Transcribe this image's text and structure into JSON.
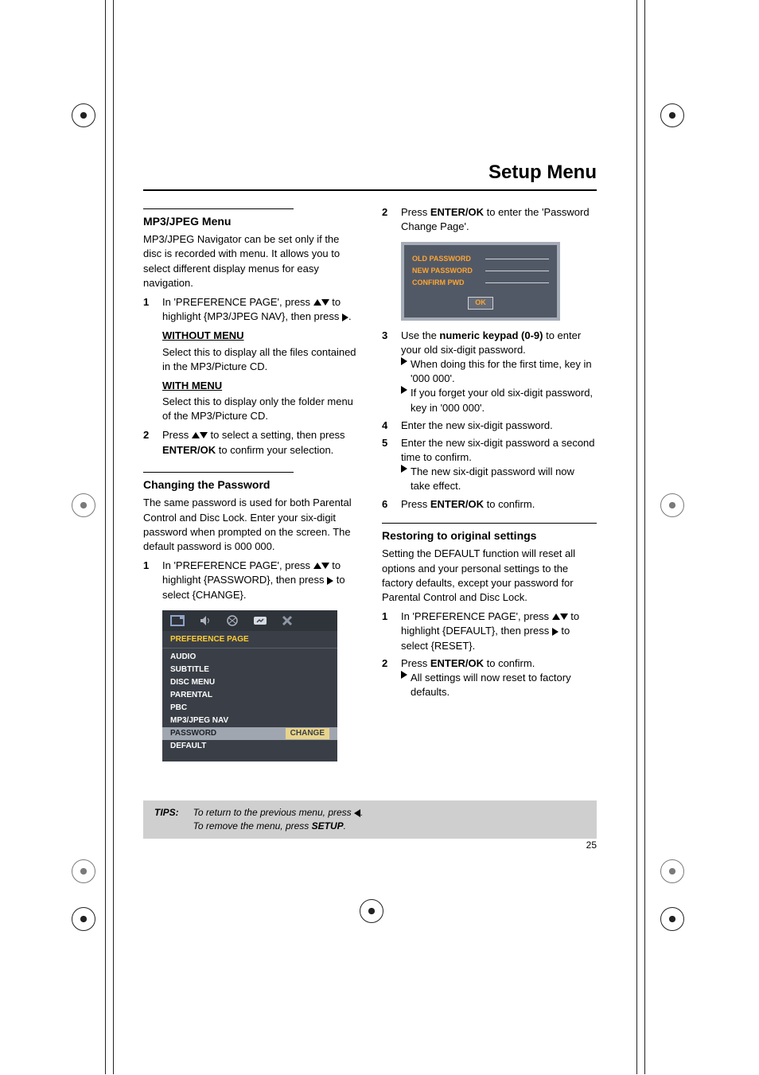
{
  "header": {
    "title": "Setup Menu"
  },
  "left": {
    "mp3jpeg": {
      "heading": "MP3/JPEG Menu",
      "intro": "MP3/JPEG Navigator can be set only if the disc is recorded with menu. It allows you to select different display menus for easy navigation.",
      "step1_a": "In 'PREFERENCE PAGE', press ",
      "step1_b": " to highlight {MP3/JPEG NAV}, then press ",
      "step1_c": ".",
      "without_h": "WITHOUT MENU",
      "without_t": "Select this to display all the files contained in the MP3/Picture CD.",
      "with_h": "WITH MENU",
      "with_t": "Select this to display only the folder menu of the MP3/Picture CD.",
      "step2_a": "Press ",
      "step2_b": " to select a setting, then press ",
      "step2_enter": "ENTER/OK",
      "step2_c": " to confirm your selection."
    },
    "pw": {
      "heading": "Changing the Password",
      "intro": "The same password is used for both Parental Control and Disc Lock. Enter your six-digit password when prompted on the screen. The default password is 000 000.",
      "step1_a": "In 'PREFERENCE PAGE', press ",
      "step1_b": " to highlight {PASSWORD}, then press ",
      "step1_c": " to select {CHANGE}."
    },
    "osd": {
      "title": "PREFERENCE PAGE",
      "rows": [
        {
          "k": "AUDIO",
          "v": ""
        },
        {
          "k": "SUBTITLE",
          "v": ""
        },
        {
          "k": "DISC MENU",
          "v": ""
        },
        {
          "k": "PARENTAL",
          "v": ""
        },
        {
          "k": "PBC",
          "v": ""
        },
        {
          "k": "MP3/JPEG NAV",
          "v": ""
        },
        {
          "k": "PASSWORD",
          "v": "CHANGE",
          "sel": true
        },
        {
          "k": "DEFAULT",
          "v": ""
        }
      ]
    }
  },
  "right": {
    "step2_a": "Press ",
    "step2_enter": "ENTER/OK",
    "step2_b": " to enter the 'Password Change Page'.",
    "pwd": {
      "old": "OLD PASSWORD",
      "new": "NEW PASSWORD",
      "confirm": "CONFIRM PWD",
      "ok": "OK"
    },
    "step3_a": "Use the ",
    "step3_bold": "numeric keypad (0-9)",
    "step3_b": " to enter your old six-digit password.",
    "step3_bul1": "When doing this for the first time, key in '000 000'.",
    "step3_bul2": "If you forget your old six-digit password, key in '000 000'.",
    "step4": "Enter the new six-digit password.",
    "step5": "Enter the new six-digit password a second time to confirm.",
    "step5_bul": "The new six-digit password will now take effect.",
    "step6_a": "Press ",
    "step6_enter": "ENTER/OK",
    "step6_b": " to confirm.",
    "restore": {
      "heading": "Restoring to original settings",
      "intro": "Setting the DEFAULT function will reset all options and your personal settings to the factory defaults, except your password for Parental Control and Disc Lock.",
      "step1_a": "In 'PREFERENCE PAGE', press ",
      "step1_b": " to highlight {DEFAULT}, then press ",
      "step1_c": " to select {RESET}.",
      "step2_a": "Press ",
      "step2_enter": "ENTER/OK",
      "step2_b": " to confirm.",
      "step2_bul": "All settings will now reset to factory defaults."
    }
  },
  "tips": {
    "label": "TIPS:",
    "l1_a": "To return to the previous menu, press ",
    "l1_b": ".",
    "l2_a": "To remove the menu, press ",
    "l2_bold": "SETUP",
    "l2_b": "."
  },
  "page_number": "25"
}
